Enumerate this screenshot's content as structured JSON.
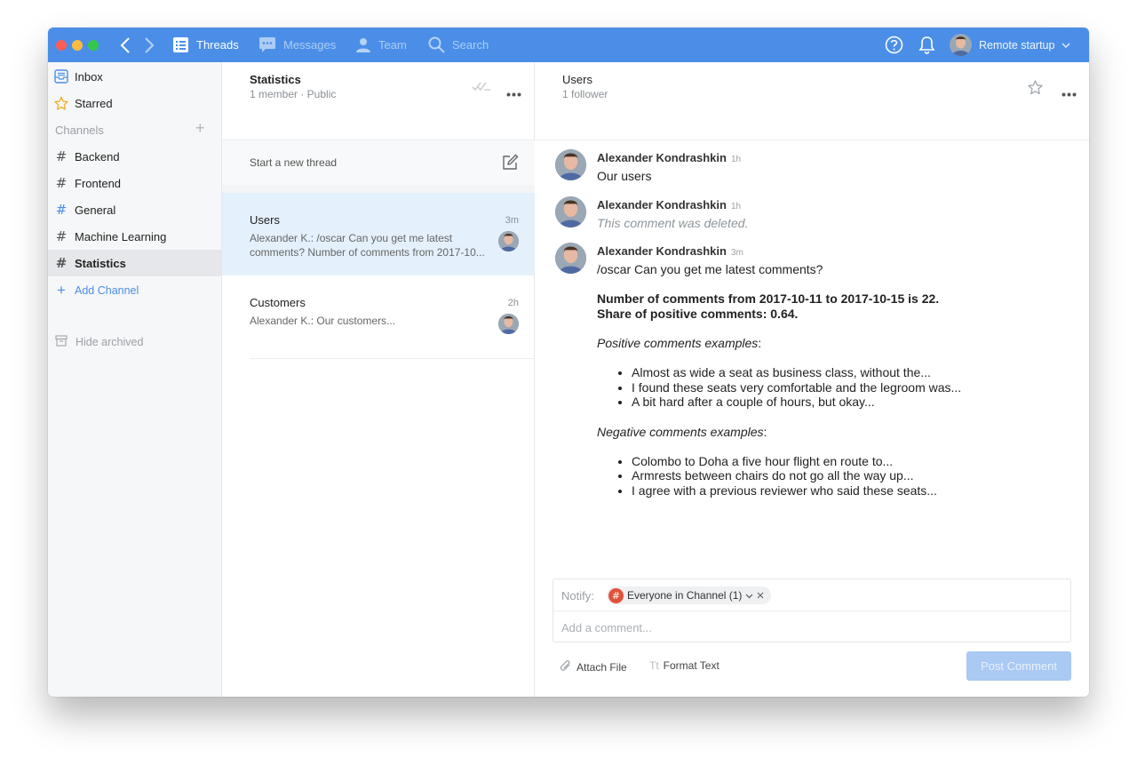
{
  "topbar": {
    "tabs": [
      {
        "label": "Threads",
        "icon": "threads-icon",
        "active": true
      },
      {
        "label": "Messages",
        "icon": "messages-icon",
        "active": false
      },
      {
        "label": "Team",
        "icon": "team-icon",
        "active": false
      },
      {
        "label": "Search",
        "icon": "search-icon",
        "active": false
      }
    ],
    "account_name": "Remote startup",
    "accent": "#4a8ee8"
  },
  "sidebar": {
    "inbox": "Inbox",
    "starred": "Starred",
    "channels_header": "Channels",
    "channels": [
      {
        "label": "Backend",
        "active": false
      },
      {
        "label": "Frontend",
        "active": false
      },
      {
        "label": "General",
        "active": false
      },
      {
        "label": "Machine Learning",
        "active": false
      },
      {
        "label": "Statistics",
        "active": true
      }
    ],
    "add_channel": "Add Channel",
    "hide_archived": "Hide archived"
  },
  "channel": {
    "title": "Statistics",
    "meta": "1 member · Public",
    "new_thread": "Start a new thread"
  },
  "threads": [
    {
      "title": "Users",
      "time": "3m",
      "preview": "Alexander K.: /oscar Can you get me latest comments?  Number of comments from 2017-10...",
      "selected": true
    },
    {
      "title": "Customers",
      "time": "2h",
      "preview": "Alexander K.: Our customers...",
      "selected": false
    }
  ],
  "thread_view": {
    "title": "Users",
    "followers": "1 follower",
    "messages": [
      {
        "author": "Alexander Kondrashkin",
        "time": "1h",
        "text": "Our users"
      },
      {
        "author": "Alexander Kondrashkin",
        "time": "1h",
        "text": "This comment was deleted."
      },
      {
        "author": "Alexander Kondrashkin",
        "time": "3m",
        "text": "/oscar Can you get me latest comments?",
        "bold_line_1": "Number of comments from 2017-10-11 to 2017-10-15 is 22.",
        "bold_line_2": "Share of positive comments: 0.64.",
        "positive_heading": "Positive comments examples",
        "positive": [
          "Almost as wide a seat as business class, without the...",
          "I found these seats very comfortable and the legroom was...",
          "A bit hard after a couple of hours, but okay..."
        ],
        "negative_heading": "Negative comments examples",
        "negative": [
          "Colombo to Doha a five hour flight en route to...",
          "Armrests between chairs do not go all the way up...",
          "I agree with a previous reviewer who said these seats..."
        ]
      }
    ]
  },
  "composer": {
    "notify_label": "Notify:",
    "notify_chip": "Everyone in Channel (1)",
    "placeholder": "Add a comment...",
    "attach_file": "Attach File",
    "format_text": "Format Text",
    "post_button": "Post Comment"
  }
}
